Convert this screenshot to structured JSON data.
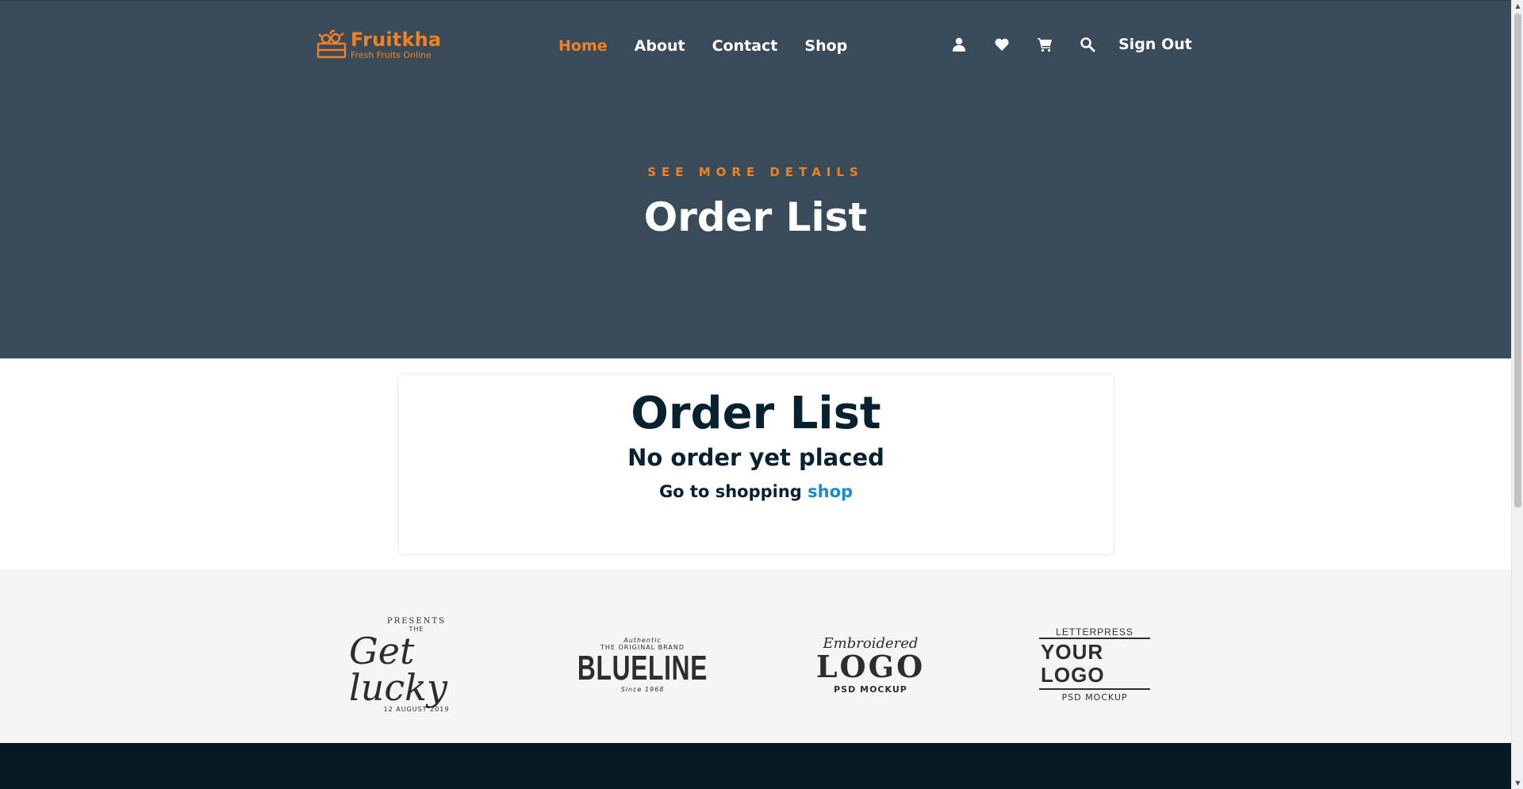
{
  "brand": {
    "name": "Fruitkha",
    "tagline": "Fresh Fruits Online",
    "color": "#f28123"
  },
  "nav": {
    "items": [
      {
        "label": "Home",
        "active": true
      },
      {
        "label": "About",
        "active": false
      },
      {
        "label": "Contact",
        "active": false
      },
      {
        "label": "Shop",
        "active": false
      }
    ],
    "tools": [
      "user-icon",
      "heart-icon",
      "cart-icon",
      "search-icon"
    ],
    "signout_label": "Sign Out"
  },
  "hero": {
    "subtitle": "SEE MORE DETAILS",
    "title": "Order List",
    "background": "#394b58"
  },
  "order_card": {
    "title": "Order List",
    "message": "No order yet placed",
    "cta_prefix": "Go to shopping",
    "cta_link": "shop",
    "link_color": "#1a8ad6"
  },
  "partner_logos": [
    {
      "top": "PRESENTS",
      "mid": "THE",
      "main": "Get lucky",
      "bottom": "12 AUGUST 2019"
    },
    {
      "top": "Authentic",
      "mid": "THE ORIGINAL BRAND",
      "main": "BLUELINE",
      "bottom": "Since 1968"
    },
    {
      "top": "Embroidered",
      "main": "LOGO",
      "bottom": "PSD MOCKUP"
    },
    {
      "top": "LETTERPRESS",
      "main": "YOUR LOGO",
      "bottom": "PSD MOCKUP"
    }
  ],
  "footer": {
    "background": "#051922"
  }
}
